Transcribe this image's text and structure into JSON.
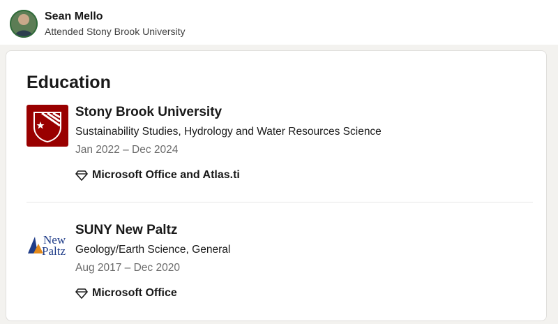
{
  "profile": {
    "name": "Sean Mello",
    "subtitle": "Attended Stony Brook University"
  },
  "section": {
    "title": "Education"
  },
  "education": [
    {
      "school": "Stony Brook University",
      "degree": "Sustainability Studies, Hydrology and Water Resources Science",
      "dates": "Jan 2022 – Dec 2024",
      "skill": "Microsoft Office and Atlas.ti",
      "logo_icon": "stony-brook-logo",
      "logo_color": "#990000"
    },
    {
      "school": "SUNY New Paltz",
      "degree": "Geology/Earth Science, General",
      "dates": "Aug 2017 – Dec 2020",
      "skill": "Microsoft Office",
      "logo_icon": "new-paltz-logo",
      "logo_text_top": "New",
      "logo_text_bottom": "Paltz",
      "logo_color": "#1f3c88"
    }
  ],
  "colors": {
    "background": "#f3f2ef",
    "card": "#ffffff",
    "text_primary": "#191919",
    "text_secondary": "#6b6b6b"
  }
}
